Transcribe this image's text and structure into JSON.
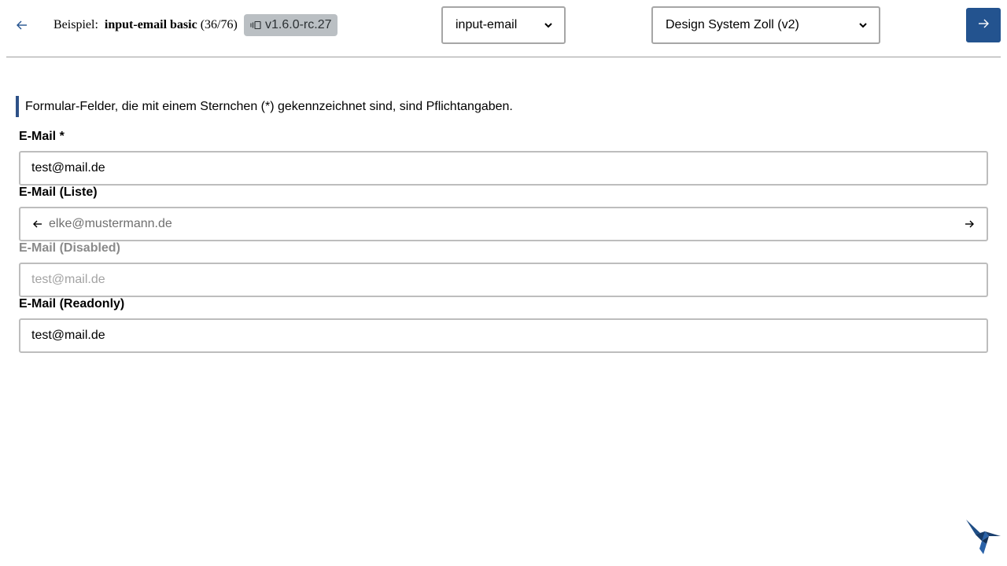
{
  "header": {
    "back_icon": "arrow-left-icon",
    "example_prefix": "Beispiel:",
    "example_name": "input-email basic",
    "example_count": "(36/76)",
    "version_icon": "versions-icon",
    "version_label": "v1.6.0-rc.27",
    "component_select": {
      "value": "input-email",
      "icon": "chevron-down-icon"
    },
    "theme_select": {
      "value": "Design System Zoll (v2)",
      "icon": "chevron-down-icon"
    },
    "next_icon": "arrow-right-icon",
    "accent_color": "#23538f"
  },
  "main": {
    "hint": "Formular-Felder, die mit einem Sternchen (*) gekennzeichnet sind, sind Pflichtangaben.",
    "fields": [
      {
        "label": "E-Mail *",
        "value": "test@mail.de",
        "state": "required"
      },
      {
        "label": "E-Mail (Liste)",
        "placeholder": "elke@mustermann.de",
        "prev_icon": "arrow-left-icon",
        "next_icon": "arrow-right-icon",
        "state": "list"
      },
      {
        "label": "E-Mail (Disabled)",
        "value": "test@mail.de",
        "state": "disabled"
      },
      {
        "label": "E-Mail (Readonly)",
        "value": "test@mail.de",
        "state": "readonly"
      }
    ]
  },
  "logo_icon": "hummingbird-logo-icon"
}
